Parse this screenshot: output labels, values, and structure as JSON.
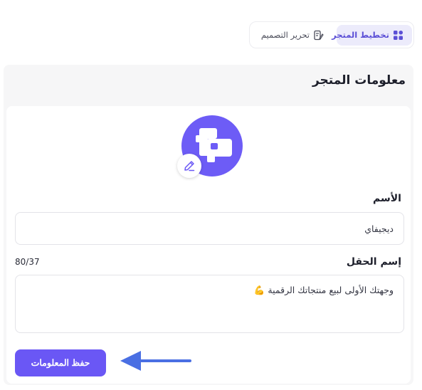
{
  "tabs": [
    {
      "label": "تخطيط المتجر",
      "icon": "layout-grid-icon",
      "active": true
    },
    {
      "label": "تحرير التصميم",
      "icon": "design-palette-icon",
      "active": false
    }
  ],
  "panel": {
    "title": "معلومات المتجر"
  },
  "avatar": {
    "icon": "store-logo-icon",
    "edit_icon": "pencil-icon"
  },
  "fields": {
    "name": {
      "label": "الأسم",
      "value": "ديجيفاي"
    },
    "description": {
      "label": "إسم الحقل",
      "value": "وجهتك الأولى لبيع منتجاتك الرقمية 💪",
      "counter": "80/37"
    }
  },
  "actions": {
    "save_label": "حفظ المعلومات"
  },
  "colors": {
    "accent": "#6a57f5",
    "accent_light": "#ecebfb",
    "arrow": "#4a6fe3"
  }
}
